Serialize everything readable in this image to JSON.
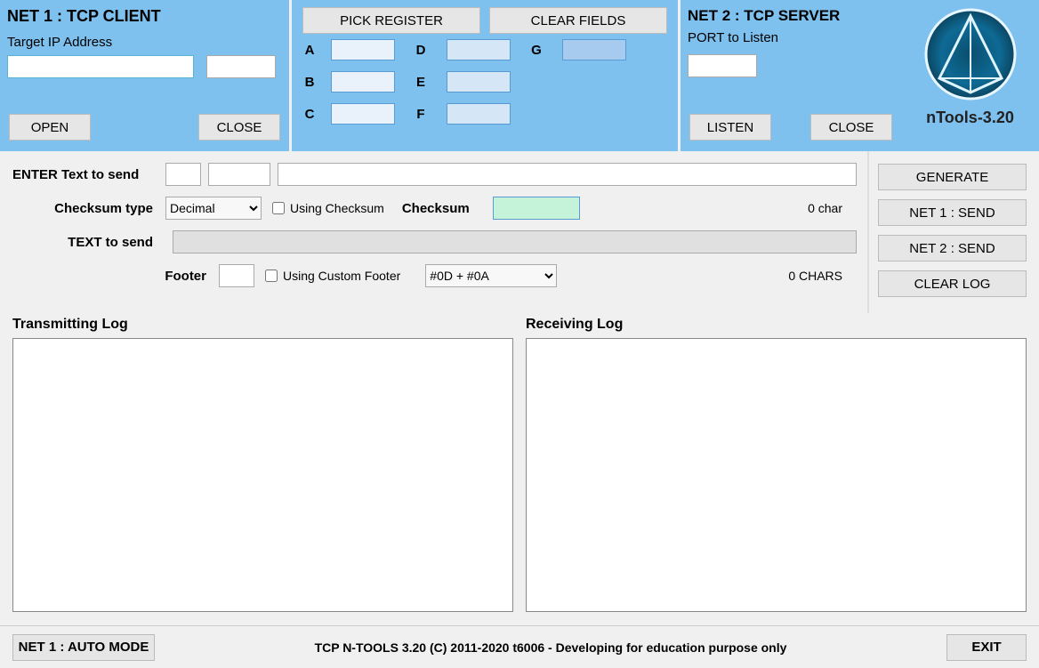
{
  "net1": {
    "title": "NET 1 : TCP CLIENT",
    "ip_label": "Target IP Address",
    "open": "OPEN",
    "close": "CLOSE"
  },
  "reg": {
    "pick": "PICK REGISTER",
    "clear": "CLEAR FIELDS",
    "labels": {
      "a": "A",
      "b": "B",
      "c": "C",
      "d": "D",
      "e": "E",
      "f": "F",
      "g": "G"
    }
  },
  "net2": {
    "title": "NET 2 : TCP SERVER",
    "port_label": "PORT to Listen",
    "listen": "LISTEN",
    "close": "CLOSE"
  },
  "brand": "nTools-3.20",
  "form": {
    "enter_label": "ENTER Text to send",
    "chk_type_label": "Checksum type",
    "chk_type_value": "Decimal",
    "using_checksum": "Using Checksum",
    "checksum_label": "Checksum",
    "char_count": "0 char",
    "text_to_send": "TEXT to send",
    "footer_label": "Footer",
    "using_custom_footer": "Using Custom Footer",
    "footer_select": "#0D + #0A",
    "chars_count": "0 CHARS"
  },
  "actions": {
    "generate": "GENERATE",
    "net1send": "NET 1 : SEND",
    "net2send": "NET 2 : SEND",
    "clearlog": "CLEAR LOG"
  },
  "logs": {
    "tx": "Transmitting Log",
    "rx": "Receiving Log"
  },
  "footer": {
    "mode": "NET 1 : AUTO MODE",
    "copyright": "TCP N-TOOLS 3.20 (C) 2011-2020 t6006 - Developing for education purpose only",
    "exit": "EXIT"
  }
}
